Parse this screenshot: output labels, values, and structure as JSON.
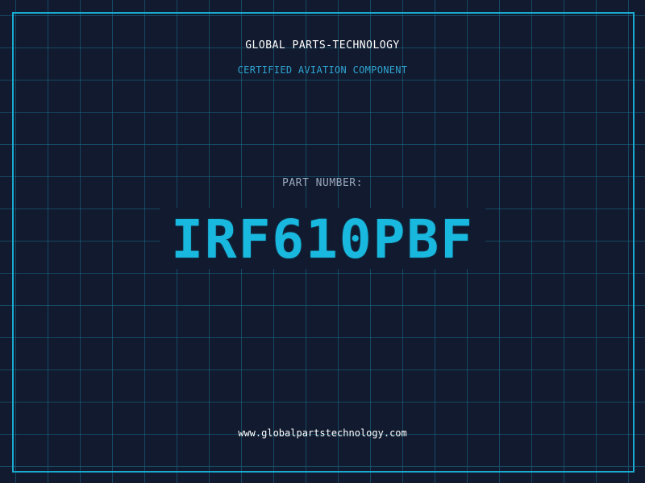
{
  "header": {
    "company": "GLOBAL PARTS-TECHNOLOGY",
    "tagline": "CERTIFIED AVIATION COMPONENT"
  },
  "part": {
    "label": "PART NUMBER:",
    "number": "IRF610PBF"
  },
  "footer": {
    "url": "www.globalpartstechnology.com"
  },
  "colors": {
    "background": "#111a2e",
    "grid": "#1a6e8c",
    "frame": "#1aa9cf",
    "accent": "#19b8df",
    "tagline": "#2fa3d0",
    "label": "#9aa8bc",
    "text": "#ffffff"
  }
}
